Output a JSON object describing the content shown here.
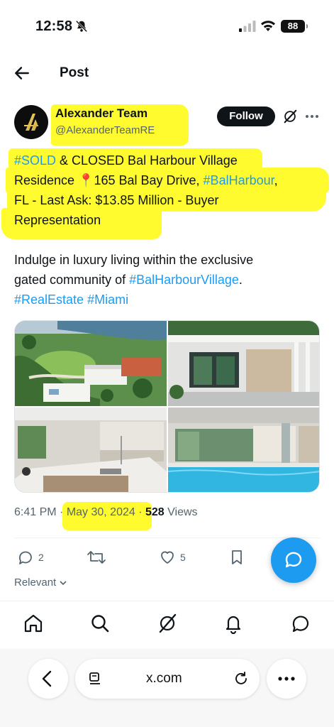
{
  "status": {
    "time": "12:58",
    "battery": "88"
  },
  "header": {
    "title": "Post"
  },
  "author": {
    "name": "Alexander Team",
    "handle": "@AlexanderTeamRE",
    "follow_label": "Follow"
  },
  "post": {
    "line1_tag": "#SOLD",
    "line1_rest": " & CLOSED Bal Harbour Village",
    "line2_a": "Residence 📍165 Bal Bay Drive, ",
    "line2_tag": "#BalHarbour",
    "line2_b": ",",
    "line3": "FL - Last Ask: $13.85 Million - Buyer",
    "line4": "Representation",
    "para2_line1": "Indulge in luxury living within the exclusive",
    "para2_line2a": "gated community of ",
    "para2_tag": "#BalHarbourVillage",
    "para2_line2b": ".",
    "tag_realestate": "#RealEstate",
    "tag_miami": "#Miami"
  },
  "meta": {
    "time": "6:41 PM",
    "separator": " · ",
    "date": "May 30, 2024",
    "views_count": "528",
    "views_label": " Views"
  },
  "actions": {
    "replies": "2",
    "likes": "5"
  },
  "sort": {
    "label": "Relevant"
  },
  "browser": {
    "url": "x.com"
  },
  "colors": {
    "highlight": "#fffb2e",
    "accent": "#1d9bf0",
    "text": "#0f1419",
    "muted": "#536471"
  }
}
